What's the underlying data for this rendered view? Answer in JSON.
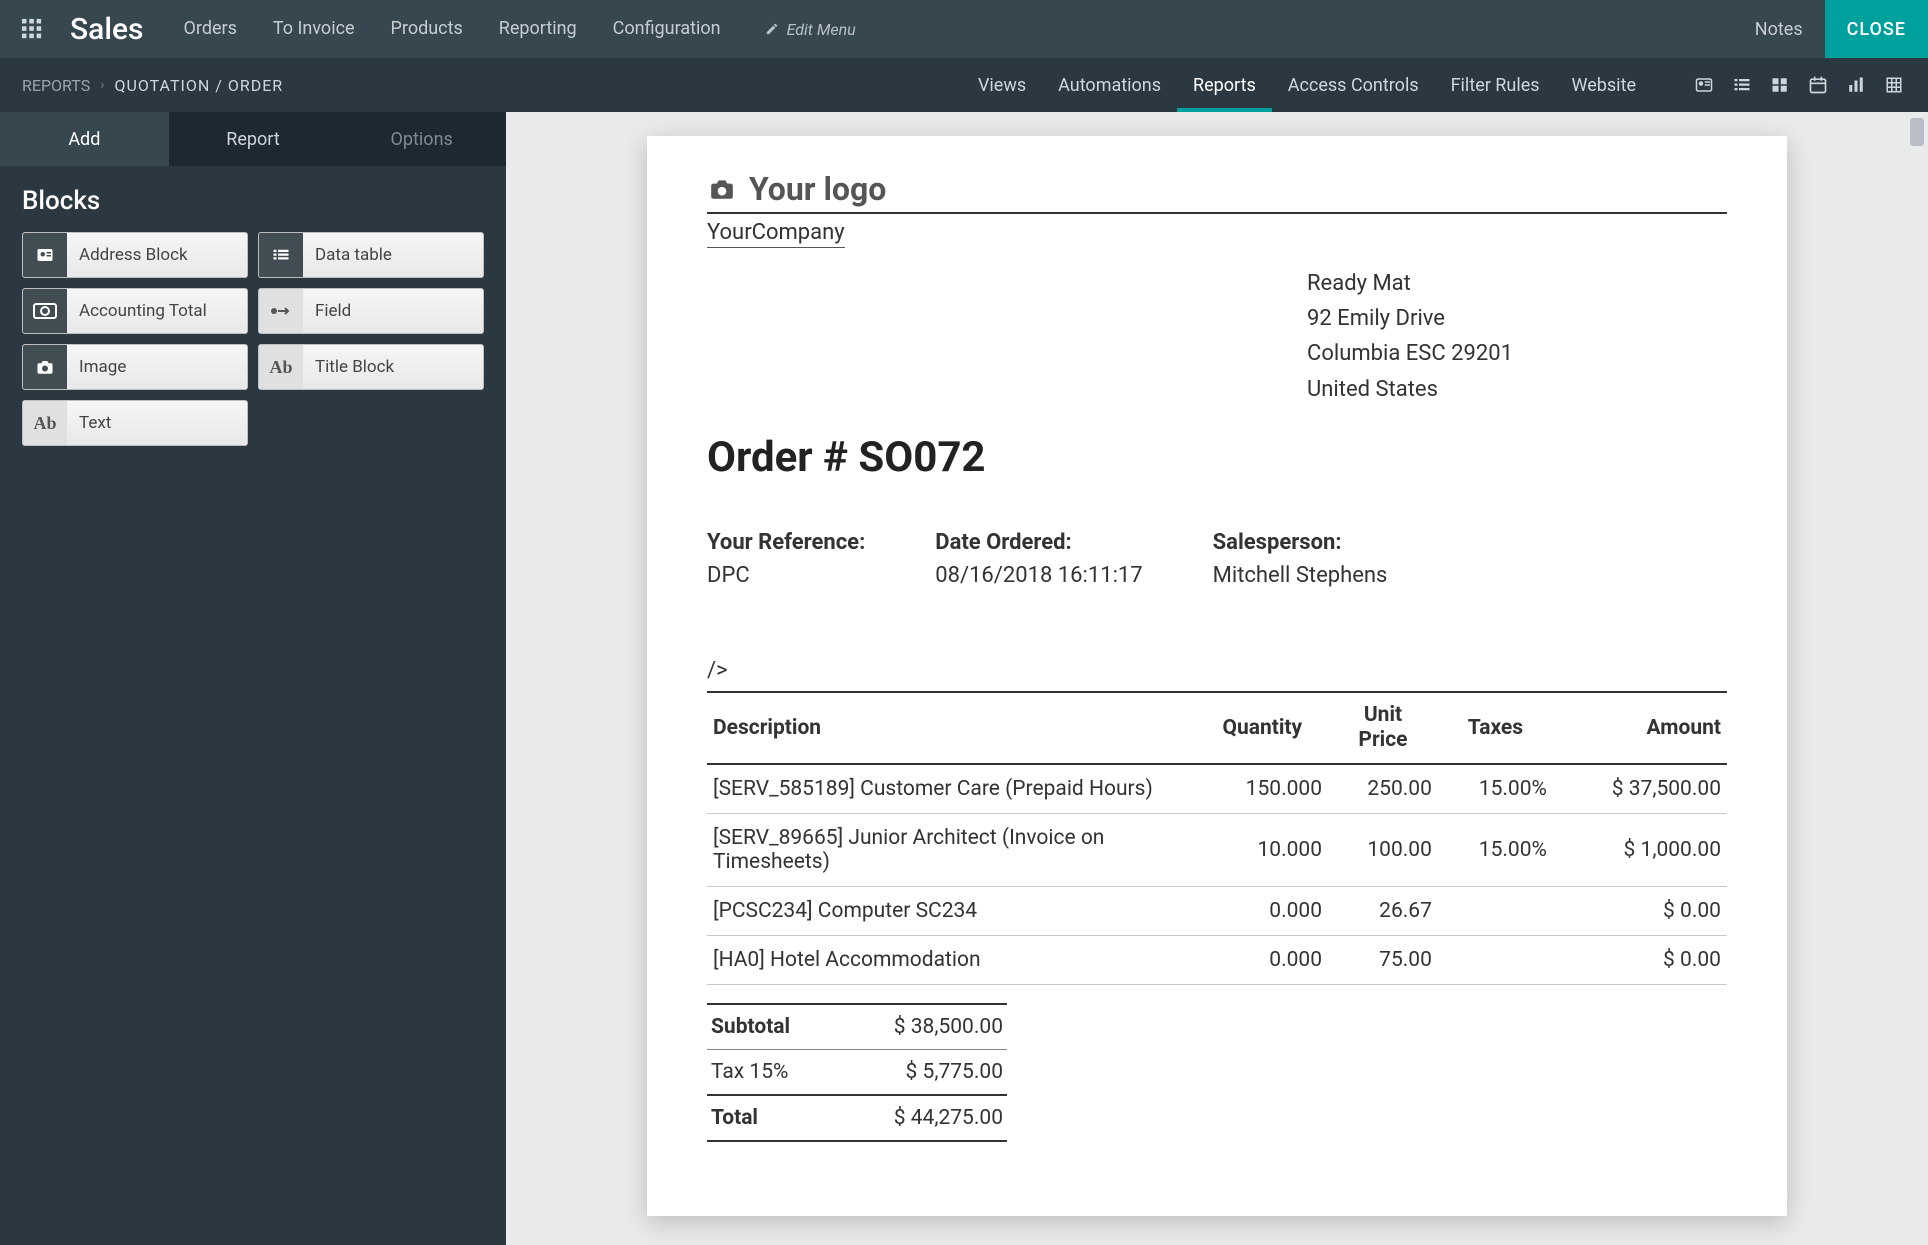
{
  "topnav": {
    "brand": "Sales",
    "menu": [
      "Orders",
      "To Invoice",
      "Products",
      "Reporting",
      "Configuration"
    ],
    "edit_menu": "Edit Menu",
    "notes": "Notes",
    "close": "CLOSE"
  },
  "subnav": {
    "breadcrumb": {
      "root": "REPORTS",
      "current": "QUOTATION / ORDER"
    },
    "tabs": [
      "Views",
      "Automations",
      "Reports",
      "Access Controls",
      "Filter Rules",
      "Website"
    ]
  },
  "sidebar": {
    "tabs": [
      "Add",
      "Report",
      "Options"
    ],
    "heading": "Blocks",
    "blocks": [
      {
        "icon": "address-card-icon",
        "label": "Address Block"
      },
      {
        "icon": "table-icon",
        "label": "Data table"
      },
      {
        "icon": "money-icon",
        "label": "Accounting Total"
      },
      {
        "icon": "arrows-icon",
        "label": "Field"
      },
      {
        "icon": "camera-icon",
        "label": "Image"
      },
      {
        "icon": "text-ab-icon",
        "label": "Title Block"
      },
      {
        "icon": "text-ab-icon",
        "label": "Text"
      }
    ]
  },
  "report": {
    "logo_text": "Your logo",
    "company": "YourCompany",
    "address": {
      "name": "Ready Mat",
      "street": "92 Emily Drive",
      "city": "Columbia ESC 29201",
      "country": "United States"
    },
    "order_title": "Order # SO072",
    "meta": [
      {
        "label": "Your Reference:",
        "value": "DPC"
      },
      {
        "label": "Date Ordered:",
        "value": "08/16/2018 16:11:17"
      },
      {
        "label": "Salesperson:",
        "value": "Mitchell Stephens"
      }
    ],
    "stray": "/>",
    "table": {
      "headers": [
        "Description",
        "Quantity",
        "Unit Price",
        "Taxes",
        "Amount"
      ],
      "rows": [
        {
          "desc": "[SERV_585189] Customer Care (Prepaid Hours)",
          "qty": "150.000",
          "price": "250.00",
          "tax": "15.00%",
          "amount": "$ 37,500.00"
        },
        {
          "desc": "[SERV_89665] Junior Architect (Invoice on Timesheets)",
          "qty": "10.000",
          "price": "100.00",
          "tax": "15.00%",
          "amount": "$ 1,000.00"
        },
        {
          "desc": "[PCSC234] Computer SC234",
          "qty": "0.000",
          "price": "26.67",
          "tax": "",
          "amount": "$ 0.00"
        },
        {
          "desc": "[HA0] Hotel Accommodation",
          "qty": "0.000",
          "price": "75.00",
          "tax": "",
          "amount": "$ 0.00"
        }
      ]
    },
    "totals": [
      {
        "label": "Subtotal",
        "value": "$ 38,500.00",
        "bold": true
      },
      {
        "label": "Tax 15%",
        "value": "$ 5,775.00",
        "bold": false
      },
      {
        "label": "Total",
        "value": "$ 44,275.00",
        "bold": true
      }
    ]
  }
}
